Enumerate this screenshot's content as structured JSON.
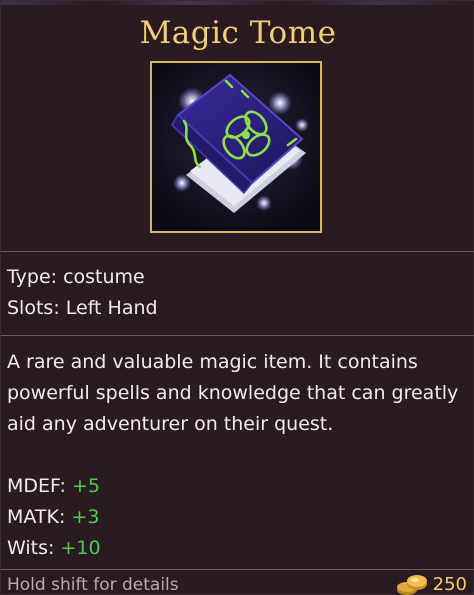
{
  "item": {
    "name": "Magic Tome",
    "icon": "magic-tome-book-icon",
    "type_line": "Type: costume",
    "slots_line": "Slots: Left Hand",
    "description": "A rare and valuable magic item. It contains powerful spells and knowledge that can greatly aid any adventurer on their quest.",
    "stats": [
      {
        "label": "MDEF:",
        "value": "+5"
      },
      {
        "label": "MATK:",
        "value": "+3"
      },
      {
        "label": "Wits:",
        "value": "+10"
      }
    ]
  },
  "footer": {
    "hint": "Hold shift for details",
    "price": "250",
    "currency_icon": "gold-coins-icon"
  },
  "colors": {
    "panel_bg": "#2a1a22",
    "title_gold": "#f2cf74",
    "frame_gold": "#d8b45e",
    "stat_green": "#48d048",
    "hint_gray": "#b7acb1"
  }
}
